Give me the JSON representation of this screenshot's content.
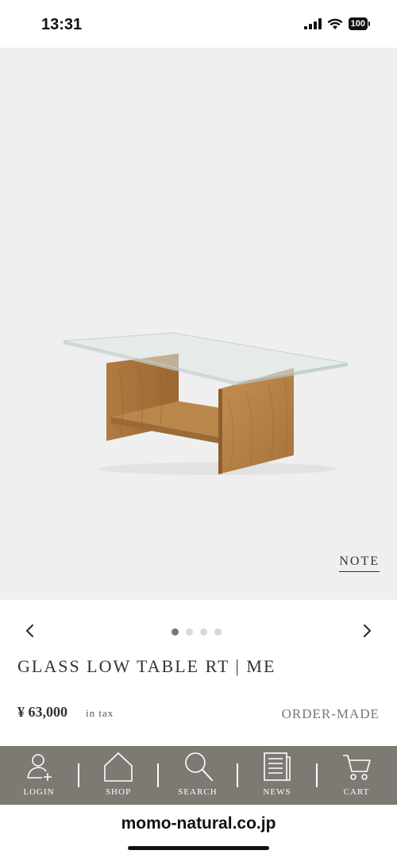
{
  "status_bar": {
    "time": "13:31",
    "battery": "100"
  },
  "hero": {
    "note_label": "NOTE",
    "image_name": "glass-low-table-photo"
  },
  "pager": {
    "total": 4,
    "active_index": 0
  },
  "product": {
    "title": "GLASS LOW TABLE RT | ME",
    "price": "¥ 63,000",
    "price_note": "in tax",
    "badge": "ORDER-MADE"
  },
  "nav": [
    {
      "label": "LOGIN",
      "icon": "login-user-icon"
    },
    {
      "label": "SHOP",
      "icon": "home-icon"
    },
    {
      "label": "SEARCH",
      "icon": "search-icon"
    },
    {
      "label": "NEWS",
      "icon": "news-icon"
    },
    {
      "label": "CART",
      "icon": "cart-icon"
    }
  ],
  "browser": {
    "url": "momo-natural.co.jp"
  },
  "colors": {
    "hero_bg": "#efefef",
    "nav_bg": "#7c7a73",
    "text": "#333333"
  }
}
